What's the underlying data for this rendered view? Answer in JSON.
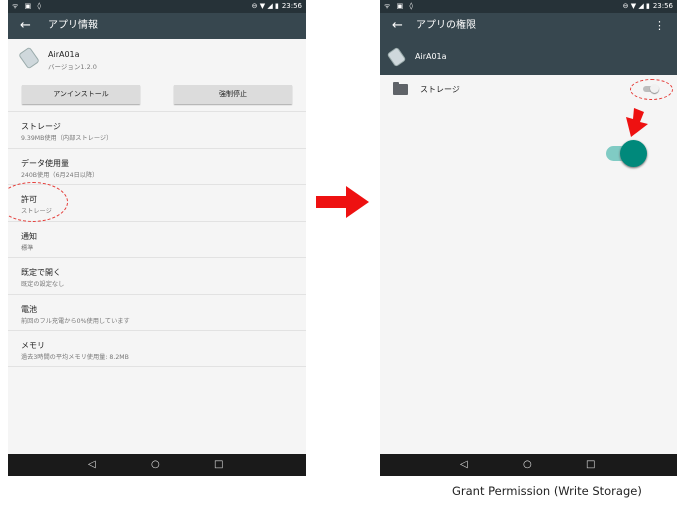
{
  "status_bar": {
    "time": "23:56",
    "left_icons": "ᯤ ▣ ◊",
    "right_icons": "⊖ ▼ ◢ ▮"
  },
  "left_screen": {
    "title": "アプリ情報",
    "app_name": "AirA01a",
    "app_version": "バージョン1.2.0",
    "buttons": {
      "uninstall": "アンインストール",
      "force_stop": "強制停止"
    },
    "items": [
      {
        "title": "ストレージ",
        "subtitle": "9.39MB使用（内部ストレージ）"
      },
      {
        "title": "データ使用量",
        "subtitle": "240B使用（6月24日以降）"
      },
      {
        "title": "許可",
        "subtitle": "ストレージ"
      },
      {
        "title": "通知",
        "subtitle": "標準"
      },
      {
        "title": "既定で開く",
        "subtitle": "既定の設定なし"
      },
      {
        "title": "電池",
        "subtitle": "前回のフル充電から0%使用しています"
      },
      {
        "title": "メモリ",
        "subtitle": "過去3時間の平均メモリ使用量: 8.2MB"
      }
    ]
  },
  "right_screen": {
    "title": "アプリの権限",
    "app_name": "AirA01a",
    "permission_label": "ストレージ",
    "storage_toggle_before": false,
    "storage_toggle_after": true
  },
  "nav": {
    "back": "◁",
    "home": "○",
    "recents": "□"
  },
  "icons": {
    "back": "←",
    "menu": "⋮",
    "arrow_right": "arrow-right-icon",
    "arrow_down": "arrow-down-icon"
  },
  "colors": {
    "toolbar": "#37474f",
    "status": "#263238",
    "accent": "#00897b",
    "highlight": "#e53935"
  },
  "caption": "Grant Permission (Write Storage)"
}
